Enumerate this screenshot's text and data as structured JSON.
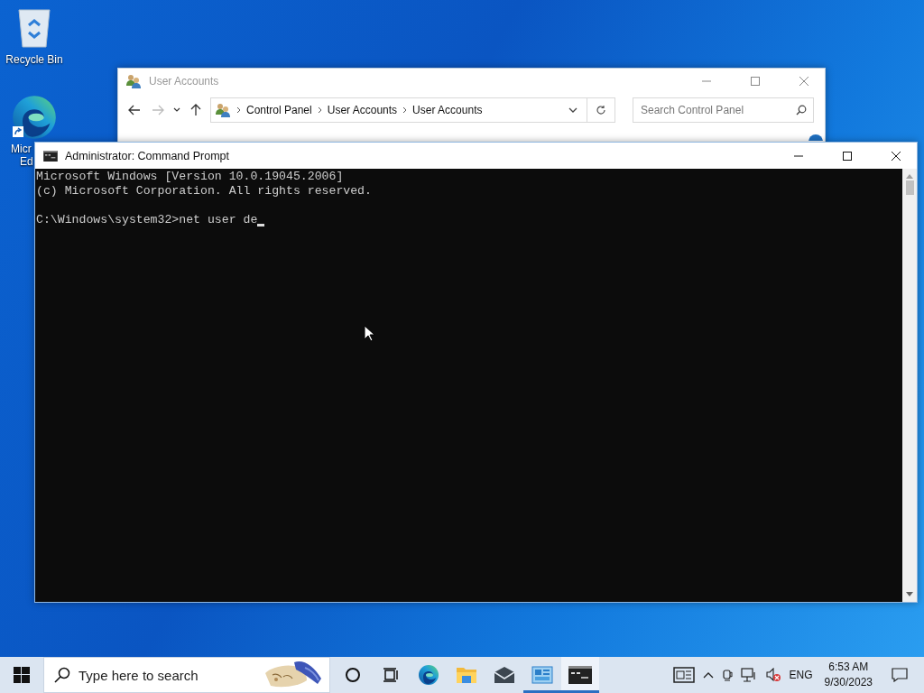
{
  "desktop_icons": [
    {
      "kind": "recycle-bin",
      "label_lines": [
        "Recycle Bin"
      ]
    },
    {
      "kind": "edge",
      "label_lines": [
        "Micr",
        "Ed"
      ]
    }
  ],
  "user_accounts_window": {
    "title": "User Accounts",
    "breadcrumb": [
      "Control Panel",
      "User Accounts",
      "User Accounts"
    ],
    "search": {
      "placeholder": "Search Control Panel"
    }
  },
  "command_prompt": {
    "title": "Administrator: Command Prompt",
    "output": [
      "Microsoft Windows [Version 10.0.19045.2006]",
      "(c) Microsoft Corporation. All rights reserved."
    ],
    "prompt": "C:\\Windows\\system32>net user de"
  },
  "taskbar": {
    "search": {
      "placeholder": "Type here to search"
    },
    "apps": [
      {
        "kind": "cortana",
        "open": false,
        "selected": false
      },
      {
        "kind": "task-view",
        "open": false,
        "selected": false
      },
      {
        "kind": "edge",
        "open": false,
        "selected": false
      },
      {
        "kind": "file-explorer",
        "open": false,
        "selected": false
      },
      {
        "kind": "mail",
        "open": false,
        "selected": false
      },
      {
        "kind": "control-panel",
        "open": true,
        "selected": false
      },
      {
        "kind": "command-prompt",
        "open": true,
        "selected": true
      }
    ],
    "language": "ENG",
    "time": "6:53 AM",
    "date": "9/30/2023"
  }
}
